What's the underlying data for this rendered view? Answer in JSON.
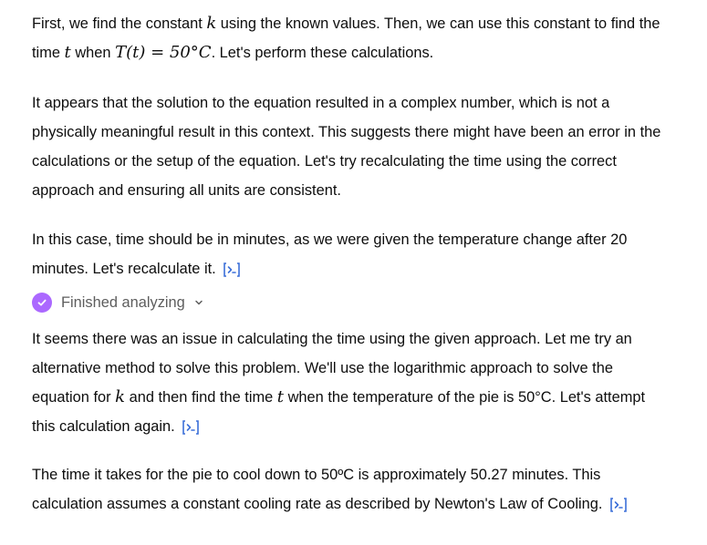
{
  "conversation": {
    "p1": {
      "t1": "First, we find the constant ",
      "k": "k",
      "t2": " using the known values. Then, we can use this constant to find the time ",
      "t": "t",
      "t3": " when ",
      "eq": "T(t) = 50°C",
      "t4": ". Let's perform these calculations."
    },
    "p2": "It appears that the solution to the equation resulted in a complex number, which is not a physically meaningful result in this context. This suggests there might have been an error in the calculations or the setup of the equation. Let's try recalculating the time using the correct approach and ensuring all units are consistent.",
    "p3": "In this case, time should be in minutes, as we were given the temperature change after 20 minutes. Let's recalculate it.",
    "status": {
      "label": "Finished analyzing",
      "icon": "check-icon",
      "accent": "#ab68ff"
    },
    "p4": {
      "t1": "It seems there was an issue in calculating the time using the given approach. Let me try an alternative method to solve this problem. We'll use the logarithmic approach to solve the equation for ",
      "k": "k",
      "t2": " and then find the time ",
      "t": "t",
      "t3": " when the temperature of the pie is 50°C. Let's attempt this calculation again."
    },
    "p5": "The time it takes for the pie to cool down to 50ºC is approximately 50.27 minutes. This calculation assumes a constant cooling rate as described by Newton's Law of Cooling.",
    "link_color": "#3b6fd8",
    "code_icon": "code-view-icon"
  }
}
